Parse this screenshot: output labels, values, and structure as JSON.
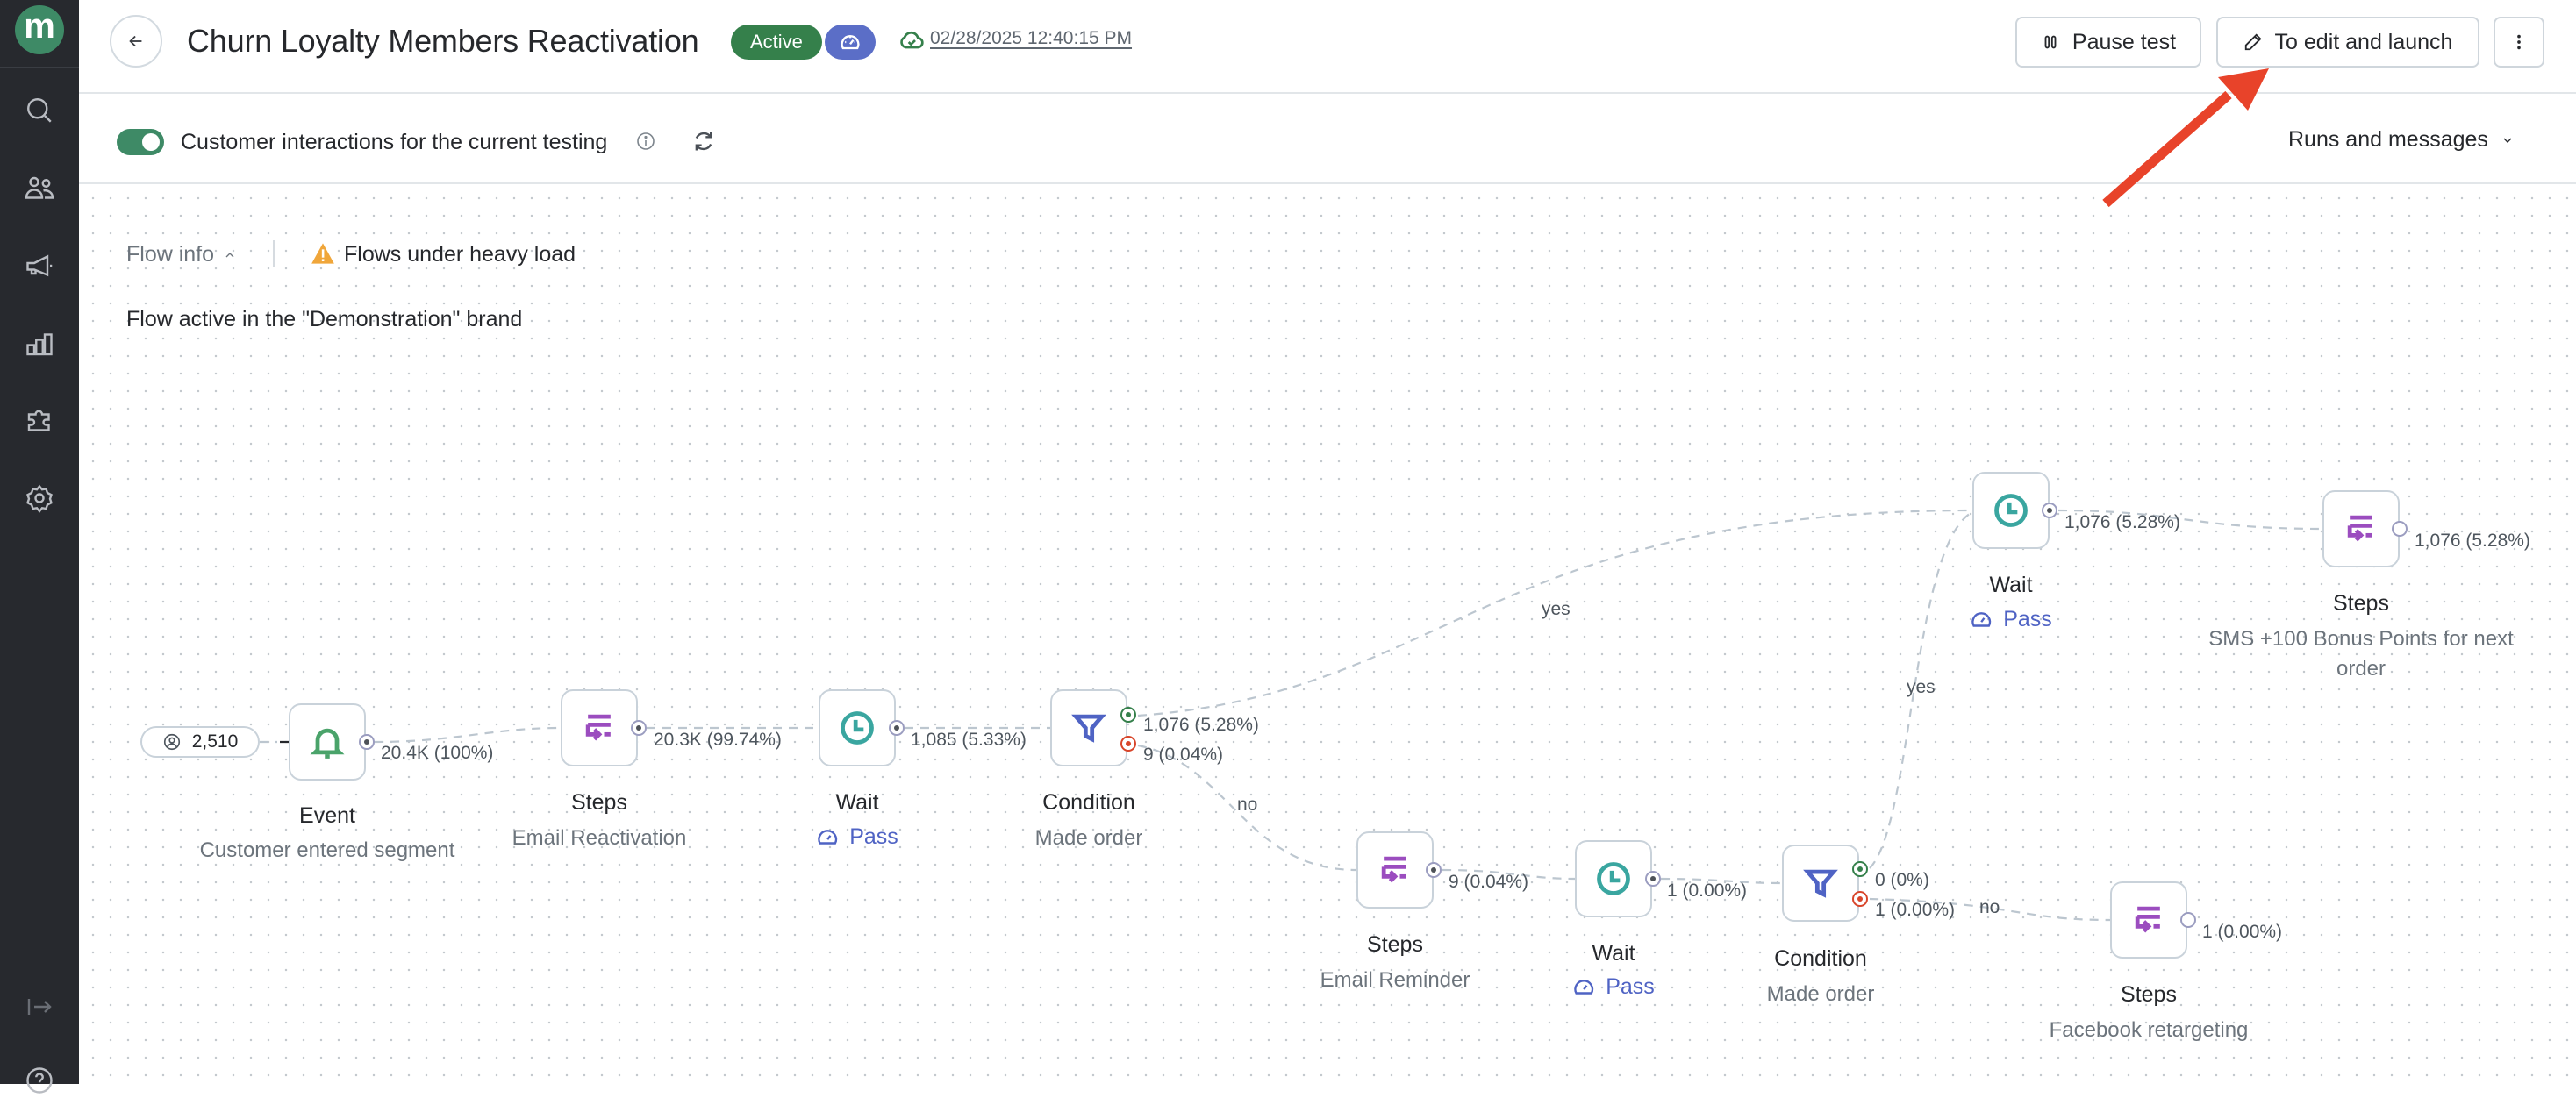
{
  "sidebar": {
    "logo_letter": "m",
    "items": [
      {
        "icon": "search-icon"
      },
      {
        "icon": "users-icon"
      },
      {
        "icon": "megaphone-icon"
      },
      {
        "icon": "analytics-icon"
      },
      {
        "icon": "puzzle-icon"
      },
      {
        "icon": "gear-icon"
      }
    ],
    "bottom": [
      {
        "icon": "expand-sidebar-icon"
      },
      {
        "icon": "help-icon"
      }
    ]
  },
  "header": {
    "title": "Churn Loyalty Members Reactivation",
    "status_badge": "Active",
    "saved_at": "02/28/2025 12:40:15 PM",
    "buttons": {
      "pause": "Pause test",
      "edit": "To edit and launch"
    }
  },
  "toolbar": {
    "toggle_on": true,
    "toggle_label": "Customer interactions for the current testing",
    "runs_dropdown": "Runs and messages"
  },
  "flow_panel": {
    "flow_info_label": "Flow info",
    "warning": "Flows under heavy load",
    "brand_text": "Flow active in the \"Demonstration\" brand"
  },
  "flow": {
    "entry_count": "2,510",
    "nodes": {
      "event": {
        "title": "Event",
        "subtitle": "Customer entered segment",
        "count": "20.4K (100%)"
      },
      "steps_reactivation": {
        "title": "Steps",
        "subtitle": "Email Reactivation",
        "count": "20.3K (99.74%)"
      },
      "wait_1": {
        "title": "Wait",
        "status": "Pass",
        "count": "1,085 (5.33%)"
      },
      "condition_1": {
        "title": "Condition",
        "subtitle": "Made order",
        "yes_count": "1,076 (5.28%)",
        "no_count": "9 (0.04%)"
      },
      "wait_2": {
        "title": "Wait",
        "status": "Pass",
        "count": "1,076 (5.28%)"
      },
      "steps_sms": {
        "title": "Steps",
        "subtitle": "SMS +100 Bonus Points for next order",
        "count": "1,076 (5.28%)"
      },
      "steps_reminder": {
        "title": "Steps",
        "subtitle": "Email Reminder",
        "count": "9 (0.04%)"
      },
      "wait_3": {
        "title": "Wait",
        "status": "Pass",
        "count": "1 (0.00%)"
      },
      "condition_2": {
        "title": "Condition",
        "subtitle": "Made order",
        "yes_count": "0 (0%)",
        "no_count": "1 (0.00%)"
      },
      "steps_facebook": {
        "title": "Steps",
        "subtitle": "Facebook retargeting",
        "count": "1 (0.00%)"
      }
    },
    "edge_labels": {
      "yes_1": "yes",
      "no_1": "no",
      "yes_2": "yes",
      "no_2": "no"
    }
  },
  "colors": {
    "brand_green": "#3e8a66",
    "active_badge": "#35804b",
    "speed_badge": "#5b6ec7",
    "pass_blue": "#4f63c4",
    "steps_purple": "#9b4dbf",
    "wait_teal": "#3aa6a0",
    "condition_blue": "#4f63c4",
    "event_green": "#4aa36a",
    "no_port_red": "#d8452a",
    "annotation_arrow": "#e8432a"
  }
}
